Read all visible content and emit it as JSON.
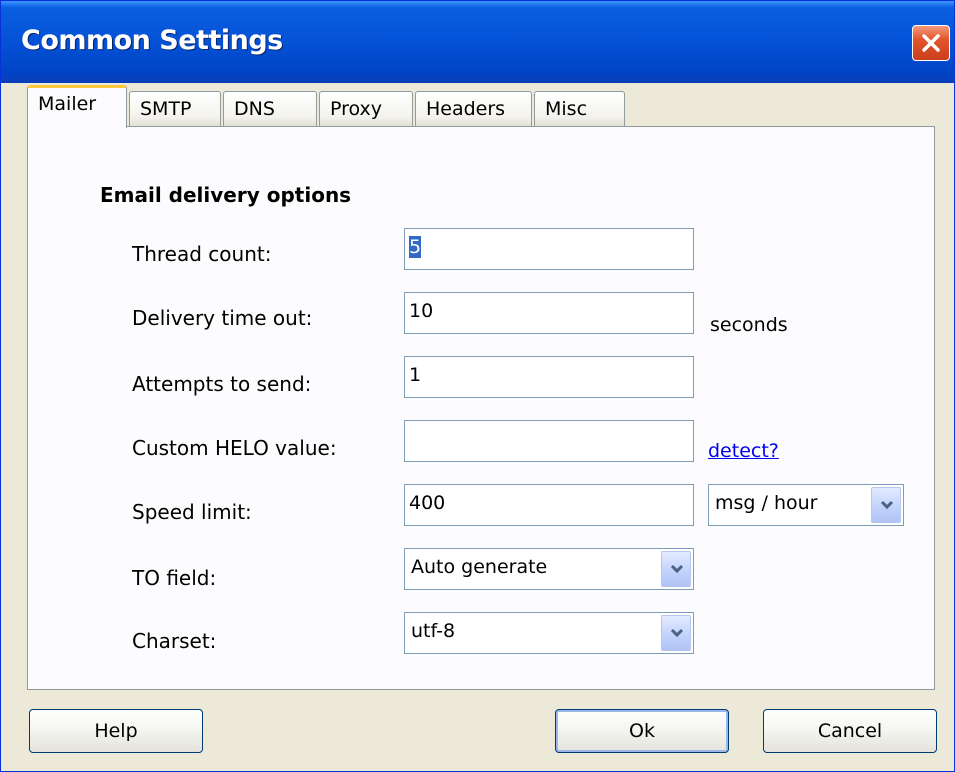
{
  "window": {
    "title": "Common Settings"
  },
  "tabs": [
    {
      "label": "Mailer",
      "active": true
    },
    {
      "label": "SMTP",
      "active": false
    },
    {
      "label": "DNS",
      "active": false
    },
    {
      "label": "Proxy",
      "active": false
    },
    {
      "label": "Headers",
      "active": false
    },
    {
      "label": "Misc",
      "active": false
    }
  ],
  "mailer": {
    "section_title": "Email delivery options",
    "thread_count": {
      "label": "Thread count:",
      "value": "5"
    },
    "delivery_timeout": {
      "label": "Delivery time out:",
      "value": "10",
      "suffix": "seconds"
    },
    "attempts": {
      "label": "Attempts to send:",
      "value": "1"
    },
    "helo": {
      "label": "Custom HELO value:",
      "value": "",
      "link": "detect?"
    },
    "speed_limit": {
      "label": "Speed limit:",
      "value": "400",
      "unit": "msg / hour"
    },
    "to_field": {
      "label": "TO field:",
      "value": "Auto generate"
    },
    "charset": {
      "label": "Charset:",
      "value": "utf-8"
    }
  },
  "buttons": {
    "help": "Help",
    "ok": "Ok",
    "cancel": "Cancel"
  },
  "colors": {
    "titlebar": "#0553d8",
    "close": "#e2542c",
    "active_tab_accent": "#ffc83c",
    "link": "#0000ee"
  },
  "icons": {
    "close": "close-icon",
    "dropdown": "chevron-down-icon"
  }
}
